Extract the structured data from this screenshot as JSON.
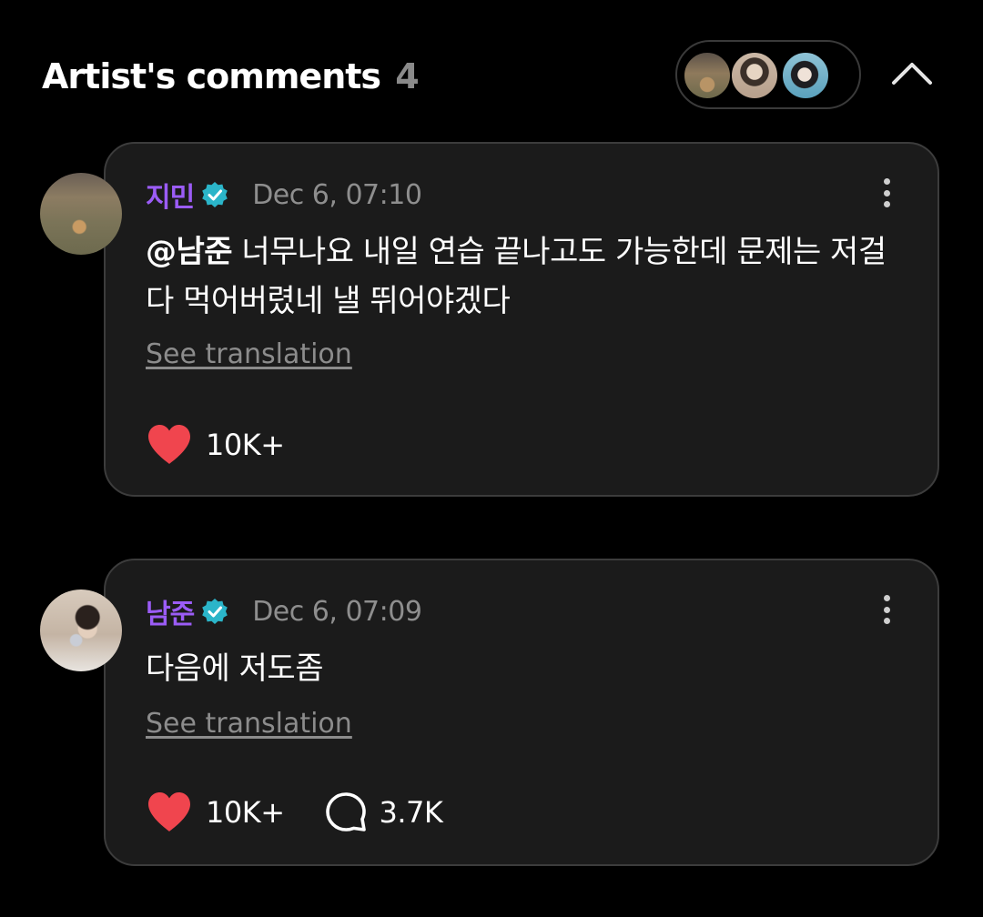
{
  "header": {
    "title": "Artist's comments",
    "count": "4"
  },
  "colors": {
    "background": "#000000",
    "card": "#1b1b1b",
    "author": "#9b5cf6",
    "verified": "#2bb5c9",
    "heart": "#f0454e"
  },
  "icons": {
    "collapse": "chevron-up-icon",
    "verified": "verified-badge-icon",
    "like": "heart-icon",
    "reply": "speech-bubble-icon",
    "more": "more-vertical-icon"
  },
  "comments": [
    {
      "author": "지민",
      "date": "Dec 6, 07:10",
      "mention": "@남준",
      "text": " 너무나요 내일 연습 끝나고도 가능한데 문제는 저걸 다 먹어버렸네 낼 뛰어야겠다",
      "see_translation": "See translation",
      "likes": "10K+"
    },
    {
      "author": "남준",
      "date": "Dec 6, 07:09",
      "text": "다음에 저도좀",
      "see_translation": "See translation",
      "likes": "10K+",
      "replies": "3.7K"
    }
  ]
}
